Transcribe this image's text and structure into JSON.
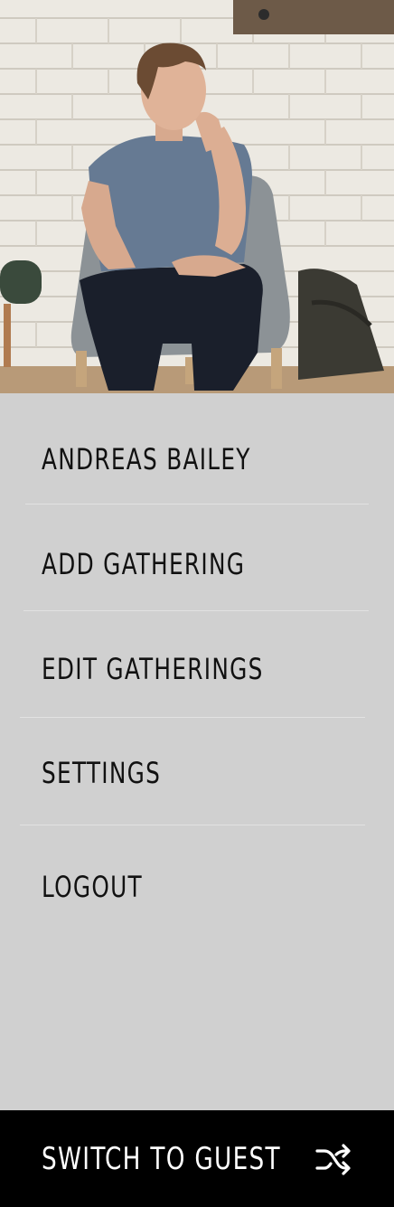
{
  "profile": {
    "photo_icon": "profile-photo"
  },
  "menu": {
    "items": [
      {
        "label": "ANDREAS BAILEY"
      },
      {
        "label": "ADD GATHERING"
      },
      {
        "label": "EDIT GATHERINGS"
      },
      {
        "label": "SETTINGS"
      },
      {
        "label": "LOGOUT"
      }
    ]
  },
  "footer": {
    "label": "SWITCH TO GUEST",
    "icon": "shuffle-icon"
  },
  "colors": {
    "menu_background": "#d0d0d0",
    "footer_background": "#000000",
    "footer_text": "#ffffff",
    "menu_text": "#111111"
  }
}
